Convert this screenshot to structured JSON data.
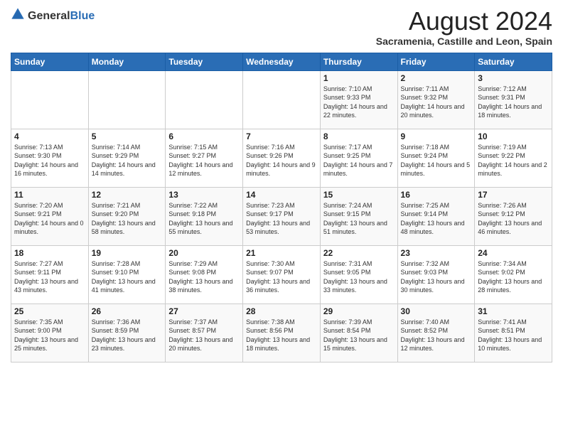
{
  "logo": {
    "general": "General",
    "blue": "Blue"
  },
  "header": {
    "month": "August 2024",
    "location": "Sacramenia, Castille and Leon, Spain"
  },
  "weekdays": [
    "Sunday",
    "Monday",
    "Tuesday",
    "Wednesday",
    "Thursday",
    "Friday",
    "Saturday"
  ],
  "weeks": [
    [
      {
        "day": "",
        "sunrise": "",
        "sunset": "",
        "daylight": ""
      },
      {
        "day": "",
        "sunrise": "",
        "sunset": "",
        "daylight": ""
      },
      {
        "day": "",
        "sunrise": "",
        "sunset": "",
        "daylight": ""
      },
      {
        "day": "",
        "sunrise": "",
        "sunset": "",
        "daylight": ""
      },
      {
        "day": "1",
        "sunrise": "Sunrise: 7:10 AM",
        "sunset": "Sunset: 9:33 PM",
        "daylight": "Daylight: 14 hours and 22 minutes."
      },
      {
        "day": "2",
        "sunrise": "Sunrise: 7:11 AM",
        "sunset": "Sunset: 9:32 PM",
        "daylight": "Daylight: 14 hours and 20 minutes."
      },
      {
        "day": "3",
        "sunrise": "Sunrise: 7:12 AM",
        "sunset": "Sunset: 9:31 PM",
        "daylight": "Daylight: 14 hours and 18 minutes."
      }
    ],
    [
      {
        "day": "4",
        "sunrise": "Sunrise: 7:13 AM",
        "sunset": "Sunset: 9:30 PM",
        "daylight": "Daylight: 14 hours and 16 minutes."
      },
      {
        "day": "5",
        "sunrise": "Sunrise: 7:14 AM",
        "sunset": "Sunset: 9:29 PM",
        "daylight": "Daylight: 14 hours and 14 minutes."
      },
      {
        "day": "6",
        "sunrise": "Sunrise: 7:15 AM",
        "sunset": "Sunset: 9:27 PM",
        "daylight": "Daylight: 14 hours and 12 minutes."
      },
      {
        "day": "7",
        "sunrise": "Sunrise: 7:16 AM",
        "sunset": "Sunset: 9:26 PM",
        "daylight": "Daylight: 14 hours and 9 minutes."
      },
      {
        "day": "8",
        "sunrise": "Sunrise: 7:17 AM",
        "sunset": "Sunset: 9:25 PM",
        "daylight": "Daylight: 14 hours and 7 minutes."
      },
      {
        "day": "9",
        "sunrise": "Sunrise: 7:18 AM",
        "sunset": "Sunset: 9:24 PM",
        "daylight": "Daylight: 14 hours and 5 minutes."
      },
      {
        "day": "10",
        "sunrise": "Sunrise: 7:19 AM",
        "sunset": "Sunset: 9:22 PM",
        "daylight": "Daylight: 14 hours and 2 minutes."
      }
    ],
    [
      {
        "day": "11",
        "sunrise": "Sunrise: 7:20 AM",
        "sunset": "Sunset: 9:21 PM",
        "daylight": "Daylight: 14 hours and 0 minutes."
      },
      {
        "day": "12",
        "sunrise": "Sunrise: 7:21 AM",
        "sunset": "Sunset: 9:20 PM",
        "daylight": "Daylight: 13 hours and 58 minutes."
      },
      {
        "day": "13",
        "sunrise": "Sunrise: 7:22 AM",
        "sunset": "Sunset: 9:18 PM",
        "daylight": "Daylight: 13 hours and 55 minutes."
      },
      {
        "day": "14",
        "sunrise": "Sunrise: 7:23 AM",
        "sunset": "Sunset: 9:17 PM",
        "daylight": "Daylight: 13 hours and 53 minutes."
      },
      {
        "day": "15",
        "sunrise": "Sunrise: 7:24 AM",
        "sunset": "Sunset: 9:15 PM",
        "daylight": "Daylight: 13 hours and 51 minutes."
      },
      {
        "day": "16",
        "sunrise": "Sunrise: 7:25 AM",
        "sunset": "Sunset: 9:14 PM",
        "daylight": "Daylight: 13 hours and 48 minutes."
      },
      {
        "day": "17",
        "sunrise": "Sunrise: 7:26 AM",
        "sunset": "Sunset: 9:12 PM",
        "daylight": "Daylight: 13 hours and 46 minutes."
      }
    ],
    [
      {
        "day": "18",
        "sunrise": "Sunrise: 7:27 AM",
        "sunset": "Sunset: 9:11 PM",
        "daylight": "Daylight: 13 hours and 43 minutes."
      },
      {
        "day": "19",
        "sunrise": "Sunrise: 7:28 AM",
        "sunset": "Sunset: 9:10 PM",
        "daylight": "Daylight: 13 hours and 41 minutes."
      },
      {
        "day": "20",
        "sunrise": "Sunrise: 7:29 AM",
        "sunset": "Sunset: 9:08 PM",
        "daylight": "Daylight: 13 hours and 38 minutes."
      },
      {
        "day": "21",
        "sunrise": "Sunrise: 7:30 AM",
        "sunset": "Sunset: 9:07 PM",
        "daylight": "Daylight: 13 hours and 36 minutes."
      },
      {
        "day": "22",
        "sunrise": "Sunrise: 7:31 AM",
        "sunset": "Sunset: 9:05 PM",
        "daylight": "Daylight: 13 hours and 33 minutes."
      },
      {
        "day": "23",
        "sunrise": "Sunrise: 7:32 AM",
        "sunset": "Sunset: 9:03 PM",
        "daylight": "Daylight: 13 hours and 30 minutes."
      },
      {
        "day": "24",
        "sunrise": "Sunrise: 7:34 AM",
        "sunset": "Sunset: 9:02 PM",
        "daylight": "Daylight: 13 hours and 28 minutes."
      }
    ],
    [
      {
        "day": "25",
        "sunrise": "Sunrise: 7:35 AM",
        "sunset": "Sunset: 9:00 PM",
        "daylight": "Daylight: 13 hours and 25 minutes."
      },
      {
        "day": "26",
        "sunrise": "Sunrise: 7:36 AM",
        "sunset": "Sunset: 8:59 PM",
        "daylight": "Daylight: 13 hours and 23 minutes."
      },
      {
        "day": "27",
        "sunrise": "Sunrise: 7:37 AM",
        "sunset": "Sunset: 8:57 PM",
        "daylight": "Daylight: 13 hours and 20 minutes."
      },
      {
        "day": "28",
        "sunrise": "Sunrise: 7:38 AM",
        "sunset": "Sunset: 8:56 PM",
        "daylight": "Daylight: 13 hours and 18 minutes."
      },
      {
        "day": "29",
        "sunrise": "Sunrise: 7:39 AM",
        "sunset": "Sunset: 8:54 PM",
        "daylight": "Daylight: 13 hours and 15 minutes."
      },
      {
        "day": "30",
        "sunrise": "Sunrise: 7:40 AM",
        "sunset": "Sunset: 8:52 PM",
        "daylight": "Daylight: 13 hours and 12 minutes."
      },
      {
        "day": "31",
        "sunrise": "Sunrise: 7:41 AM",
        "sunset": "Sunset: 8:51 PM",
        "daylight": "Daylight: 13 hours and 10 minutes."
      }
    ]
  ]
}
